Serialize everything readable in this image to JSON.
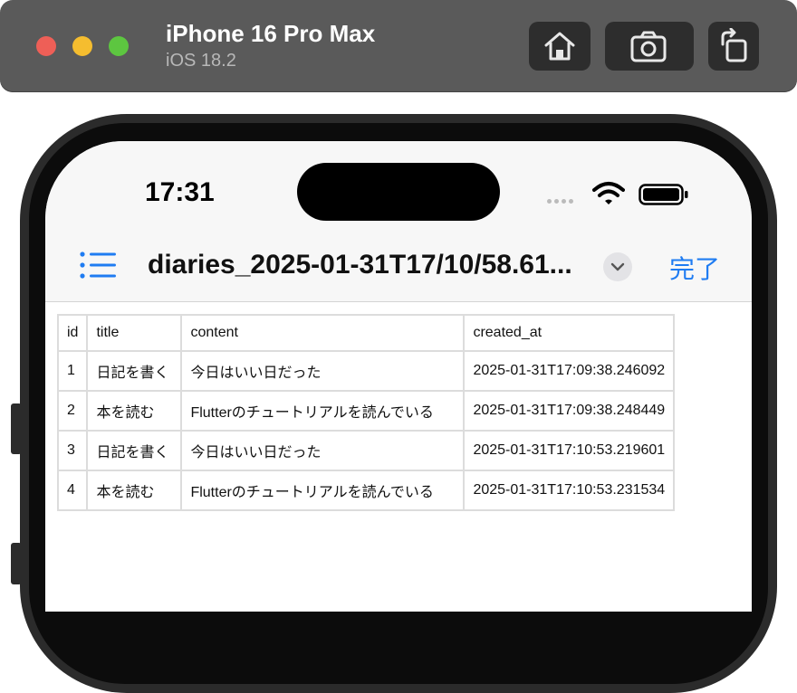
{
  "simulator": {
    "device_name": "iPhone 16 Pro Max",
    "os_version": "iOS 18.2",
    "buttons": [
      {
        "name": "home-button",
        "icon": "home-icon"
      },
      {
        "name": "screenshot-button",
        "icon": "camera-icon"
      },
      {
        "name": "rotate-button",
        "icon": "rotate-icon"
      }
    ],
    "traffic_lights": {
      "close": "#ee5f57",
      "minimize": "#f5bd2f",
      "zoom": "#5dc640"
    }
  },
  "status_bar": {
    "time": "17:31",
    "icons": [
      "signal-icon",
      "wifi-icon",
      "battery-icon"
    ]
  },
  "nav_bar": {
    "menu_icon": "list-icon",
    "title": "diaries_2025-01-31T17/10/58.61...",
    "dropdown_icon": "chevron-down-icon",
    "done_label": "完了",
    "accent_color": "#1f7cf2"
  },
  "table": {
    "columns": [
      "id",
      "title",
      "content",
      "created_at"
    ],
    "rows": [
      [
        "1",
        "日記を書く",
        "今日はいい日だった",
        "2025-01-31T17:09:38.246092"
      ],
      [
        "2",
        "本を読む",
        "Flutterのチュートリアルを読んでいる",
        "2025-01-31T17:09:38.248449"
      ],
      [
        "3",
        "日記を書く",
        "今日はいい日だった",
        "2025-01-31T17:10:53.219601"
      ],
      [
        "4",
        "本を読む",
        "Flutterのチュートリアルを読んでいる",
        "2025-01-31T17:10:53.231534"
      ]
    ]
  }
}
